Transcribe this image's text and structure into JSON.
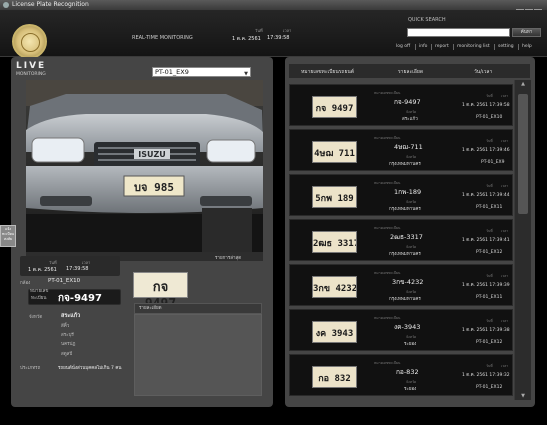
{
  "window": {
    "title": "License Plate Recognition"
  },
  "header": {
    "realtime_label": "REAL-TIME MONITORING",
    "date_label": "วันที่",
    "time_label": "เวลา",
    "date": "1 ต.ค. 2561",
    "time": "17:39:58"
  },
  "quick_search": {
    "title": "QUICK SEARCH",
    "button": "ค้นหา",
    "value": ""
  },
  "nav": [
    "log off",
    "info",
    "report",
    "monitoring list",
    "setting",
    "help"
  ],
  "live": {
    "title": "LIVE",
    "subtitle": "MONITORING",
    "camera_select": "PT-01_EX9",
    "caption": "รายการล่าสุด",
    "side_tab": [
      "แจ้ง",
      "ทะเบียน",
      "สงสัย"
    ],
    "date_label": "วันที่",
    "time_label": "เวลา",
    "date": "1 ต.ค. 2561",
    "time": "17:39:58",
    "gate_label": "กล้อง",
    "gate": "PT-01_EX10",
    "plate_label_1": "หมายเลข",
    "plate_label_2": "ทะเบียน",
    "plate": "กจ-9497",
    "plate_image_text": "กจ 9497",
    "province_label": "จังหวัด",
    "province_options": [
      "สระแก้ว",
      "สีคิ้ว",
      "สระบุรี",
      "นครปฏ",
      "สตูลปี"
    ],
    "type_label": "ประเภทรถ",
    "type_value": "รถยนต์นั่งส่วนบุคคลไม่เกิน 7 คน",
    "detail_title": "รายละเอียด"
  },
  "table": {
    "headers": [
      "หมายเลขทะเบียนรถยนต์",
      "รายละเอียด",
      "วัน/เวลา"
    ],
    "field_plate": "หมายเลขทะเบียน",
    "field_prov": "จังหวัด",
    "field_date": "วันที่",
    "field_time": "เวลา",
    "rows": [
      {
        "img": "กจ 9497",
        "plate": "กจ-9497",
        "province": "สระแก้ว",
        "datetime": "1 ต.ค. 2561 17:39:58",
        "camera": "PT-01_EX10"
      },
      {
        "img": "4ษฌ 711",
        "plate": "4ษฌ-711",
        "province": "กรุงเทพมหานคร",
        "datetime": "1 ต.ค. 2561 17:39:46",
        "camera": "PT-01_EX9"
      },
      {
        "img": "5กพ 189",
        "plate": "1กพ-189",
        "province": "กรุงเทพมหานคร",
        "datetime": "1 ต.ค. 2561 17:39:44",
        "camera": "PT-01_EX11"
      },
      {
        "img": "2ฒธ 3317",
        "plate": "2ฒธ-3317",
        "province": "กรุงเทพมหานคร",
        "datetime": "1 ต.ค. 2561 17:39:41",
        "camera": "PT-01_EX12"
      },
      {
        "img": "3กข 4232",
        "plate": "3กข-4232",
        "province": "กรุงเทพมหานคร",
        "datetime": "1 ต.ค. 2561 17:39:39",
        "camera": "PT-01_EX11"
      },
      {
        "img": "งค 3943",
        "plate": "งค-3943",
        "province": "ระยอง",
        "datetime": "1 ต.ค. 2561 17:39:38",
        "camera": "PT-01_EX12"
      },
      {
        "img": "กอ 832",
        "plate": "กอ-832",
        "province": "ระยอง",
        "datetime": "1 ต.ค. 2561 17:39:32",
        "camera": "PT-01_EX12"
      }
    ]
  }
}
